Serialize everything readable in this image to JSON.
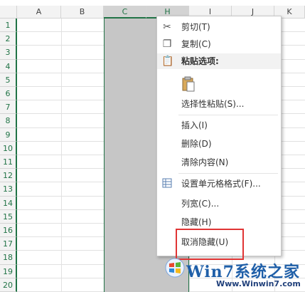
{
  "columns": [
    "A",
    "B",
    "C",
    "H",
    "I",
    "J",
    "K"
  ],
  "rows": [
    "1",
    "2",
    "3",
    "4",
    "5",
    "6",
    "7",
    "8",
    "9",
    "10",
    "11",
    "12",
    "13",
    "14",
    "15",
    "16",
    "17",
    "18",
    "19",
    "20"
  ],
  "menu": {
    "cut": "剪切(T)",
    "copy": "复制(C)",
    "paste_options": "粘贴选项:",
    "paste_special": "选择性粘贴(S)...",
    "insert": "插入(I)",
    "delete": "删除(D)",
    "clear": "清除内容(N)",
    "format_cells": "设置单元格格式(F)...",
    "column_width": "列宽(C)...",
    "hide": "隐藏(H)",
    "unhide": "取消隐藏(U)"
  },
  "watermark": {
    "brand": "Win7系统之家",
    "url": "Www.Winwin7.com"
  },
  "colors": {
    "accent": "#217346",
    "selection": "#c6c6c6",
    "highlight": "#e03434"
  }
}
